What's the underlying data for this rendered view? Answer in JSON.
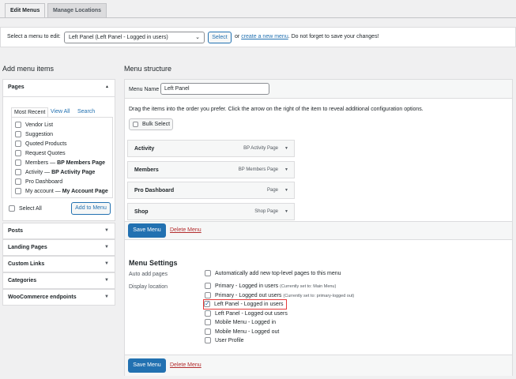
{
  "tabs": [
    "Edit Menus",
    "Manage Locations"
  ],
  "select_bar": {
    "label": "Select a menu to edit:",
    "selected": "Left Panel (Left Panel - Logged in users)",
    "button": "Select",
    "or": "or",
    "create_link": "create a new menu",
    "tail": ". Do not forget to save your changes!"
  },
  "left": {
    "heading": "Add menu items",
    "pages": {
      "title": "Pages",
      "tabs": [
        "Most Recent",
        "View All",
        "Search"
      ],
      "items": [
        "Vendor List",
        "Suggestion",
        "Quoted Products",
        "Request Quotes",
        "Members — BP Members Page",
        "Activity — BP Activity Page",
        "Pro Dashboard",
        "My account — My Account Page"
      ],
      "select_all": "Select All",
      "add_button": "Add to Menu"
    },
    "sections": [
      "Posts",
      "Landing Pages",
      "Custom Links",
      "Categories",
      "WooCommerce endpoints"
    ]
  },
  "right": {
    "heading": "Menu structure",
    "menu_name_label": "Menu Name",
    "menu_name_value": "Left Panel",
    "instructions": "Drag the items into the order you prefer. Click the arrow on the right of the item to reveal additional configuration options.",
    "bulk_select": "Bulk Select",
    "items": [
      {
        "title": "Activity",
        "type": "BP Activity Page"
      },
      {
        "title": "Members",
        "type": "BP Members Page"
      },
      {
        "title": "Pro Dashboard",
        "type": "Page"
      },
      {
        "title": "Shop",
        "type": "Shop Page"
      }
    ],
    "save": "Save Menu",
    "delete": "Delete Menu",
    "settings": {
      "heading": "Menu Settings",
      "auto_label": "Auto add pages",
      "auto_option": "Automatically add new top-level pages to this menu",
      "display_label": "Display location",
      "locations": [
        {
          "label": "Primary - Logged in users",
          "note": "(Currently set to: Main Menu)",
          "checked": false
        },
        {
          "label": "Primary - Logged out users",
          "note": "(Currently set to: primary-logged out)",
          "checked": false
        },
        {
          "label": "Left Panel - Logged in users",
          "note": "",
          "checked": true
        },
        {
          "label": "Left Panel - Logged out users",
          "note": "",
          "checked": false
        },
        {
          "label": "Mobile Menu - Logged in",
          "note": "",
          "checked": false
        },
        {
          "label": "Mobile Menu - Logged out",
          "note": "",
          "checked": false
        },
        {
          "label": "User Profile",
          "note": "",
          "checked": false
        }
      ]
    }
  },
  "colors": {
    "accent": "#2271b1",
    "highlight": "#e63b3b",
    "danger": "#b32d2e"
  }
}
